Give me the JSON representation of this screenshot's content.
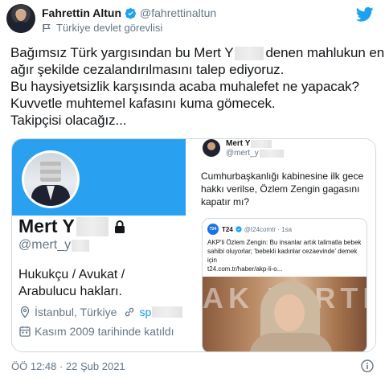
{
  "author": {
    "name": "Fahrettin Altun",
    "handle": "@fahrettinaltun",
    "label": "Türkiye devlet görevlisi"
  },
  "tweet": {
    "lines": [
      "Bağımsız Türk yargısından bu Mert Y",
      "denen mahlukun en",
      "ağır şekilde cezalandırılmasını talep ediyoruz.",
      "Bu haysiyetsizlik karşısında acaba muhalefet ne yapacak?",
      "Kuvvetle muhtemel kafasını kuma gömecek.",
      "Takipçisi olacağız..."
    ],
    "timestamp": "ÖÖ 12:48 · 22 Şub 2021"
  },
  "embedded_profile": {
    "name": "Mert Y",
    "handle": "@mert_y",
    "bio": "Hukukçu / Avukat / Arabulucu hakları.",
    "location": "İstanbul, Türkiye",
    "website": "sp",
    "joined": "Kasım 2009 tarihinde katıldı"
  },
  "embedded_tweet": {
    "name": "Mert Y",
    "handle": "@mert_y",
    "text": "Cumhurbaşkanlığı kabinesine ilk gece hakkı verilse, Özlem Zengin gagasını kapatır mı?",
    "quote": {
      "logo": "T24",
      "name": "T24",
      "handle": "@t24comtr · 1sa",
      "text": "AKP'li Özlem Zengin: Bu insanlar artık talimatla bebek sahibi oluyorlar; 'bebekli kadınlar cezaevinde' demek için",
      "link": "t24.com.tr/haber/akp-li-o...",
      "photo_text": "AK PARTI"
    }
  },
  "icons": {
    "verified": "verified-badge-icon",
    "flag": "flag-icon",
    "brand": "twitter-bird-icon",
    "lock": "lock-icon",
    "location": "location-pin-icon",
    "link": "link-icon",
    "calendar": "calendar-icon",
    "info": "info-icon"
  },
  "colors": {
    "brand": "#1da1f2",
    "banner": "#2aa1f0",
    "secondary_text": "#657786"
  }
}
